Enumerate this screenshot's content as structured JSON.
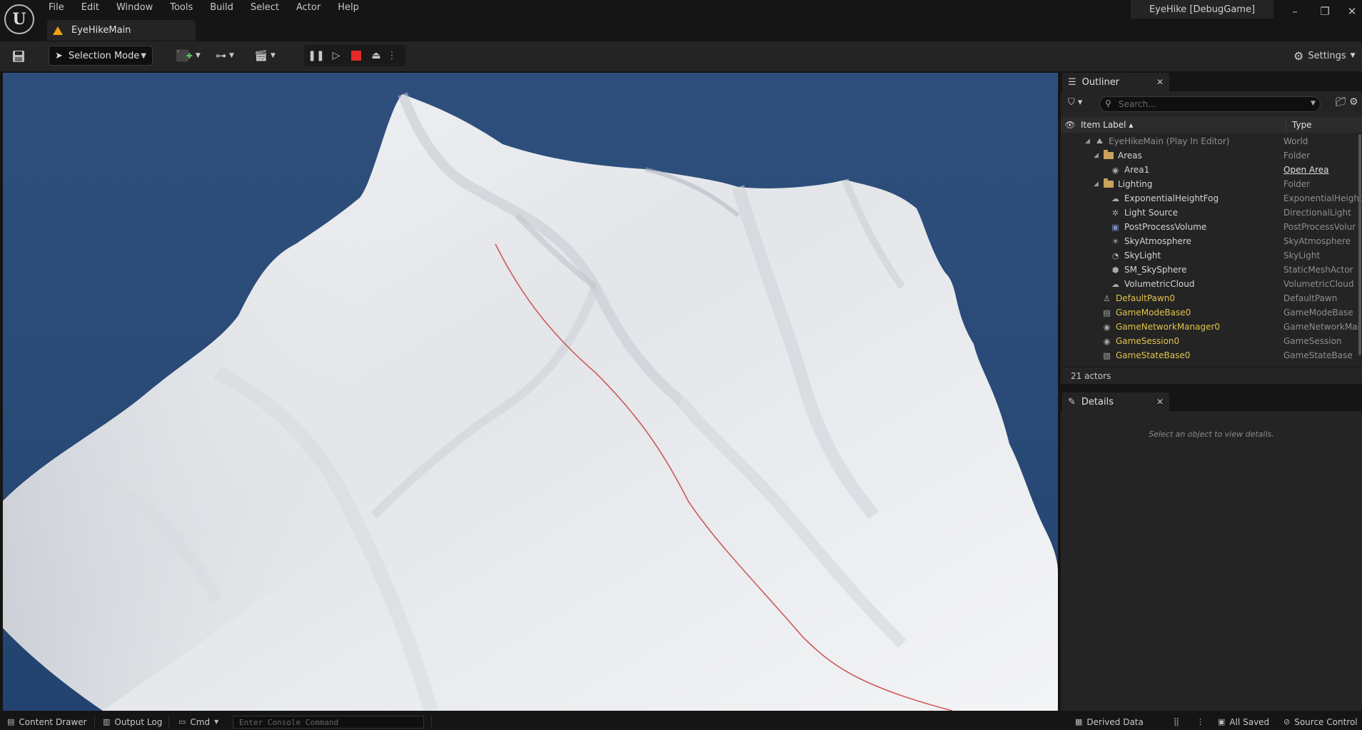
{
  "app": {
    "window_title": "EyeHike [DebugGame]",
    "level_tab": "EyeHikeMain"
  },
  "menu": [
    "File",
    "Edit",
    "Window",
    "Tools",
    "Build",
    "Select",
    "Actor",
    "Help"
  ],
  "toolbar": {
    "selection_mode": "Selection Mode",
    "settings": "Settings"
  },
  "outliner": {
    "tab": "Outliner",
    "search_placeholder": "Search...",
    "col_label": "Item Label ▴",
    "col_type": "Type",
    "rows": [
      {
        "label": "EyeHikeMain (Play In Editor)",
        "type": "World"
      },
      {
        "label": "Areas",
        "type": "Folder"
      },
      {
        "label": "Area1",
        "type": "Open Area"
      },
      {
        "label": "Lighting",
        "type": "Folder"
      },
      {
        "label": "ExponentialHeightFog",
        "type": "ExponentialHeight"
      },
      {
        "label": "Light Source",
        "type": "DirectionalLight"
      },
      {
        "label": "PostProcessVolume",
        "type": "PostProcessVolur"
      },
      {
        "label": "SkyAtmosphere",
        "type": "SkyAtmosphere"
      },
      {
        "label": "SkyLight",
        "type": "SkyLight"
      },
      {
        "label": "SM_SkySphere",
        "type": "StaticMeshActor"
      },
      {
        "label": "VolumetricCloud",
        "type": "VolumetricCloud"
      },
      {
        "label": "DefaultPawn0",
        "type": "DefaultPawn"
      },
      {
        "label": "GameModeBase0",
        "type": "GameModeBase"
      },
      {
        "label": "GameNetworkManager0",
        "type": "GameNetworkMai"
      },
      {
        "label": "GameSession0",
        "type": "GameSession"
      },
      {
        "label": "GameStateBase0",
        "type": "GameStateBase"
      }
    ],
    "footer": "21 actors"
  },
  "details": {
    "tab": "Details",
    "empty_text": "Select an object to view details."
  },
  "statusbar": {
    "content_drawer": "Content Drawer",
    "output_log": "Output Log",
    "cmd": "Cmd",
    "console_placeholder": "Enter Console Command",
    "derived_data": "Derived Data",
    "all_saved": "All Saved",
    "source_control": "Source Control"
  },
  "colors": {
    "accent_yellow": "#e2c34a",
    "stop_red": "#e52a2a",
    "sky_blue": "#2a4a77",
    "warning_orange": "#f0a30c"
  }
}
